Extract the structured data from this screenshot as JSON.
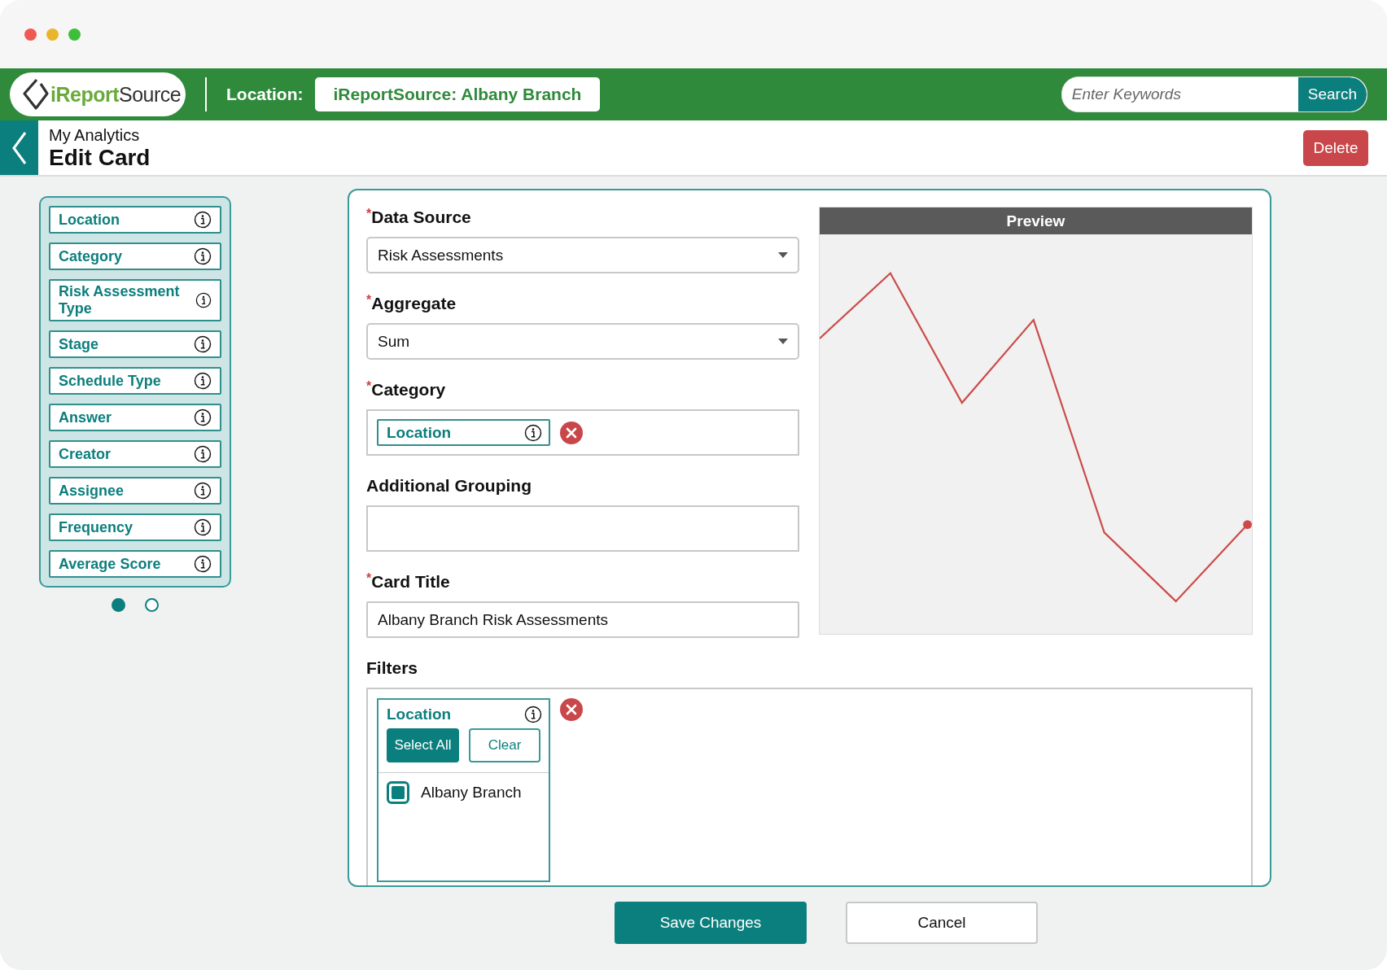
{
  "header": {
    "logo": {
      "accent": "iReport",
      "rest": "Source"
    },
    "location_label": "Location:",
    "location_value": "iReportSource: Albany Branch",
    "search": {
      "placeholder": "Enter Keywords",
      "button": "Search"
    }
  },
  "page": {
    "breadcrumb": "My Analytics",
    "title": "Edit Card",
    "delete_button": "Delete"
  },
  "field_list": {
    "items": [
      {
        "label": "Location"
      },
      {
        "label": "Category"
      },
      {
        "label": "Risk Assessment Type"
      },
      {
        "label": "Stage"
      },
      {
        "label": "Schedule Type"
      },
      {
        "label": "Answer"
      },
      {
        "label": "Creator"
      },
      {
        "label": "Assignee"
      },
      {
        "label": "Frequency"
      },
      {
        "label": "Average Score"
      }
    ],
    "pages": [
      {
        "selected": true
      },
      {
        "selected": false
      }
    ]
  },
  "form": {
    "required_mark": "*",
    "fields": [
      {
        "kind": "select",
        "label": "Data Source",
        "required": true,
        "value": "Risk Assessments"
      },
      {
        "kind": "select",
        "label": "Aggregate",
        "required": true,
        "value": "Sum"
      },
      {
        "kind": "drop",
        "label": "Category",
        "required": true,
        "chips": [
          {
            "label": "Location"
          }
        ]
      },
      {
        "kind": "drop",
        "label": "Additional Grouping",
        "required": false
      },
      {
        "kind": "text",
        "label": "Card Title",
        "required": true,
        "value": "Albany Branch Risk Assessments"
      }
    ]
  },
  "preview": {
    "title": "Preview"
  },
  "filters": {
    "label": "Filters",
    "items": [
      {
        "label": "Location",
        "select_all": "Select All",
        "clear": "Clear",
        "options": [
          {
            "label": "Albany Branch",
            "checked": true
          }
        ]
      }
    ]
  },
  "actions": {
    "save": "Save Changes",
    "cancel": "Cancel"
  }
}
